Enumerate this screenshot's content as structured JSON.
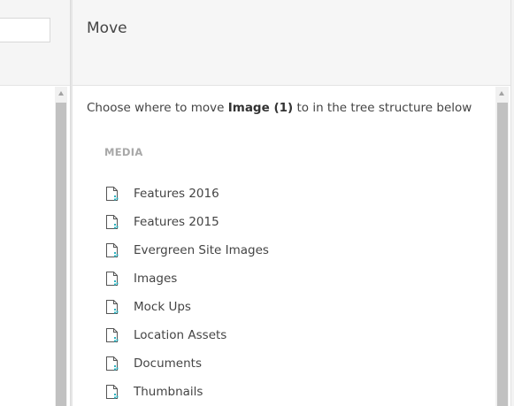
{
  "dialog": {
    "title": "Move",
    "instruction": {
      "prefix": "Choose where to move ",
      "item": "Image (1)",
      "suffix": " to in the tree structure below"
    },
    "section_label": "MEDIA",
    "tree_items": [
      {
        "label": "Features 2016",
        "icon": "file-icon"
      },
      {
        "label": "Features 2015",
        "icon": "file-icon"
      },
      {
        "label": "Evergreen Site Images",
        "icon": "file-icon"
      },
      {
        "label": "Images",
        "icon": "file-icon"
      },
      {
        "label": "Mock Ups",
        "icon": "file-icon"
      },
      {
        "label": "Location Assets",
        "icon": "file-icon"
      },
      {
        "label": "Documents",
        "icon": "file-icon"
      },
      {
        "label": "Thumbnails",
        "icon": "file-icon"
      }
    ]
  },
  "colors": {
    "icon_outline": "#555555",
    "icon_accent": "#2bb3c0",
    "section_label": "#a8a8a8",
    "header_bg": "#f6f6f6"
  }
}
